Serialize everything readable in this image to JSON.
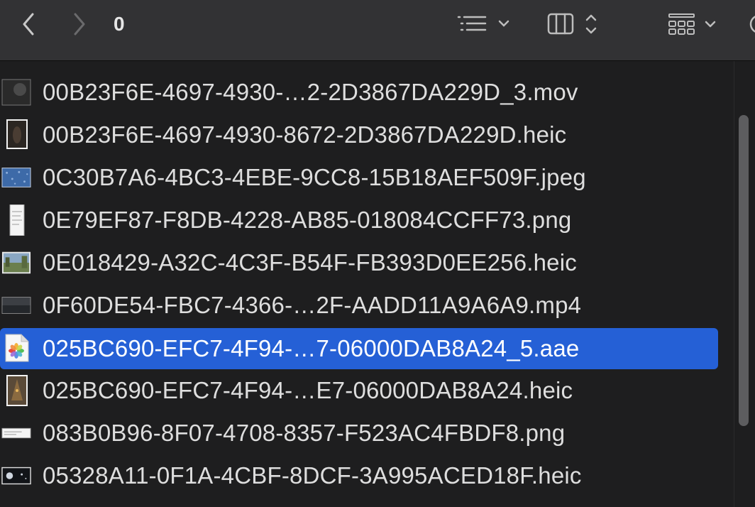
{
  "toolbar": {
    "folder_title": "0",
    "back_icon": "chevron-left-icon",
    "forward_icon": "chevron-right-icon",
    "list_view_icon": "list-view-icon",
    "column_view_icon": "column-view-icon",
    "grid_view_icon": "grid-view-icon"
  },
  "files": [
    {
      "name": "00B23F6E-4697-4930-…2-2D3867DA229D_3.mov",
      "thumb": "dark-video-thumbnail",
      "selected": false
    },
    {
      "name": "00B23F6E-4697-4930-8672-2D3867DA229D.heic",
      "thumb": "dark-photo-thumbnail",
      "selected": false
    },
    {
      "name": "0C30B7A6-4BC3-4EBE-9CC8-15B18AEF509F.jpeg",
      "thumb": "blue-photo-thumbnail",
      "selected": false
    },
    {
      "name": "0E79EF87-F8DB-4228-AB85-018084CCFF73.png",
      "thumb": "document-thumbnail",
      "selected": false
    },
    {
      "name": "0E018429-A32C-4C3F-B54F-FB393D0EE256.heic",
      "thumb": "landscape-photo-thumbnail",
      "selected": false
    },
    {
      "name": "0F60DE54-FBC7-4366-…2F-AADD11A9A6A9.mp4",
      "thumb": "dark-video-thumbnail",
      "selected": false
    },
    {
      "name": "025BC690-EFC7-4F94-…7-06000DAB8A24_5.aae",
      "thumb": "photos-file-icon",
      "selected": true
    },
    {
      "name": "025BC690-EFC7-4F94-…E7-06000DAB8A24.heic",
      "thumb": "portrait-photo-thumbnail",
      "selected": false
    },
    {
      "name": "083B0B96-8F07-4708-8357-F523AC4FBDF8.png",
      "thumb": "screenshot-thumbnail",
      "selected": false
    },
    {
      "name": "05328A11-0F1A-4CBF-8DCF-3A995ACED18F.heic",
      "thumb": "night-photo-thumbnail",
      "selected": false
    }
  ],
  "colors": {
    "selection": "#2560d6",
    "toolbar": "#323234",
    "background": "#1e1e1f",
    "text": "#dedede"
  }
}
